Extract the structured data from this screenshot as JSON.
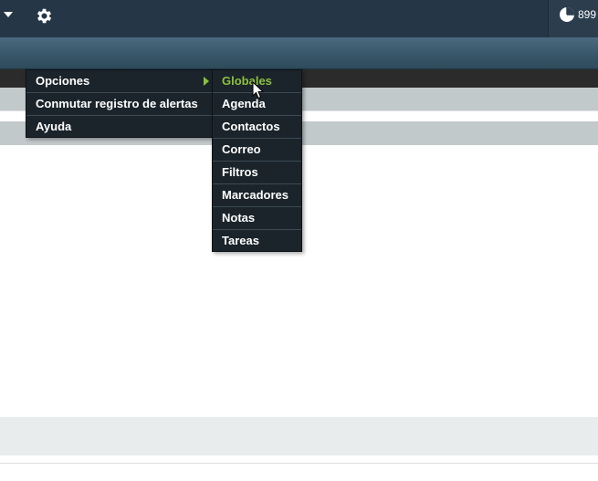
{
  "header": {
    "quota_text": "899",
    "quota_icon": "pie-chart-icon"
  },
  "toolbar": {
    "menu_caret_icon": "caret-down-icon",
    "settings_icon": "gear-icon"
  },
  "main_menu": {
    "items": [
      {
        "label": "Opciones",
        "has_submenu": true
      },
      {
        "label": "Conmutar registro de alertas",
        "has_submenu": false
      },
      {
        "label": "Ayuda",
        "has_submenu": false
      }
    ]
  },
  "options_submenu": {
    "items": [
      {
        "label": "Globales",
        "active": true
      },
      {
        "label": "Agenda"
      },
      {
        "label": "Contactos"
      },
      {
        "label": "Correo"
      },
      {
        "label": "Filtros"
      },
      {
        "label": "Marcadores"
      },
      {
        "label": "Notas"
      },
      {
        "label": "Tareas"
      }
    ]
  },
  "colors": {
    "header_bg": "#253747",
    "menu_bg": "#1b242b",
    "accent_green": "#8cbf3f",
    "band_grey": "#c2c9cb"
  }
}
